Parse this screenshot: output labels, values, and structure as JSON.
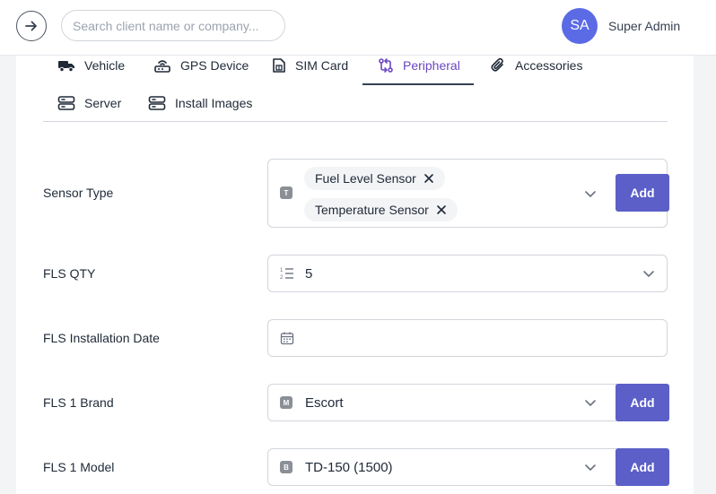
{
  "header": {
    "search_placeholder": "Search client name or company...",
    "avatar_initials": "SA",
    "user_name": "Super Admin"
  },
  "tabs": [
    {
      "label": "Vehicle",
      "icon": "truck-icon",
      "active": false
    },
    {
      "label": "GPS Device",
      "icon": "router-icon",
      "active": false
    },
    {
      "label": "SIM Card",
      "icon": "sim-card-icon",
      "active": false
    },
    {
      "label": "Peripheral",
      "icon": "git-compare-icon",
      "active": true
    },
    {
      "label": "Accessories",
      "icon": "paperclip-icon",
      "active": false
    },
    {
      "label": "Server",
      "icon": "server-icon",
      "active": false
    },
    {
      "label": "Install Images",
      "icon": "server-icon",
      "active": false
    }
  ],
  "form": {
    "sensor_type": {
      "label": "Sensor Type",
      "badge": "T",
      "chips": [
        "Fuel Level Sensor",
        "Temperature Sensor"
      ],
      "add_label": "Add"
    },
    "fls_qty": {
      "label": "FLS QTY",
      "value": "5"
    },
    "fls_installation_date": {
      "label": "FLS Installation Date",
      "value": ""
    },
    "fls_1_brand": {
      "label": "FLS 1 Brand",
      "badge": "M",
      "value": "Escort",
      "add_label": "Add"
    },
    "fls_1_model": {
      "label": "FLS 1 Model",
      "badge": "B",
      "value": "TD-150 (1500)",
      "add_label": "Add"
    }
  },
  "colors": {
    "accent": "#5b5fc7",
    "active_tab": "#6b46c1",
    "avatar": "#5b6be5"
  }
}
